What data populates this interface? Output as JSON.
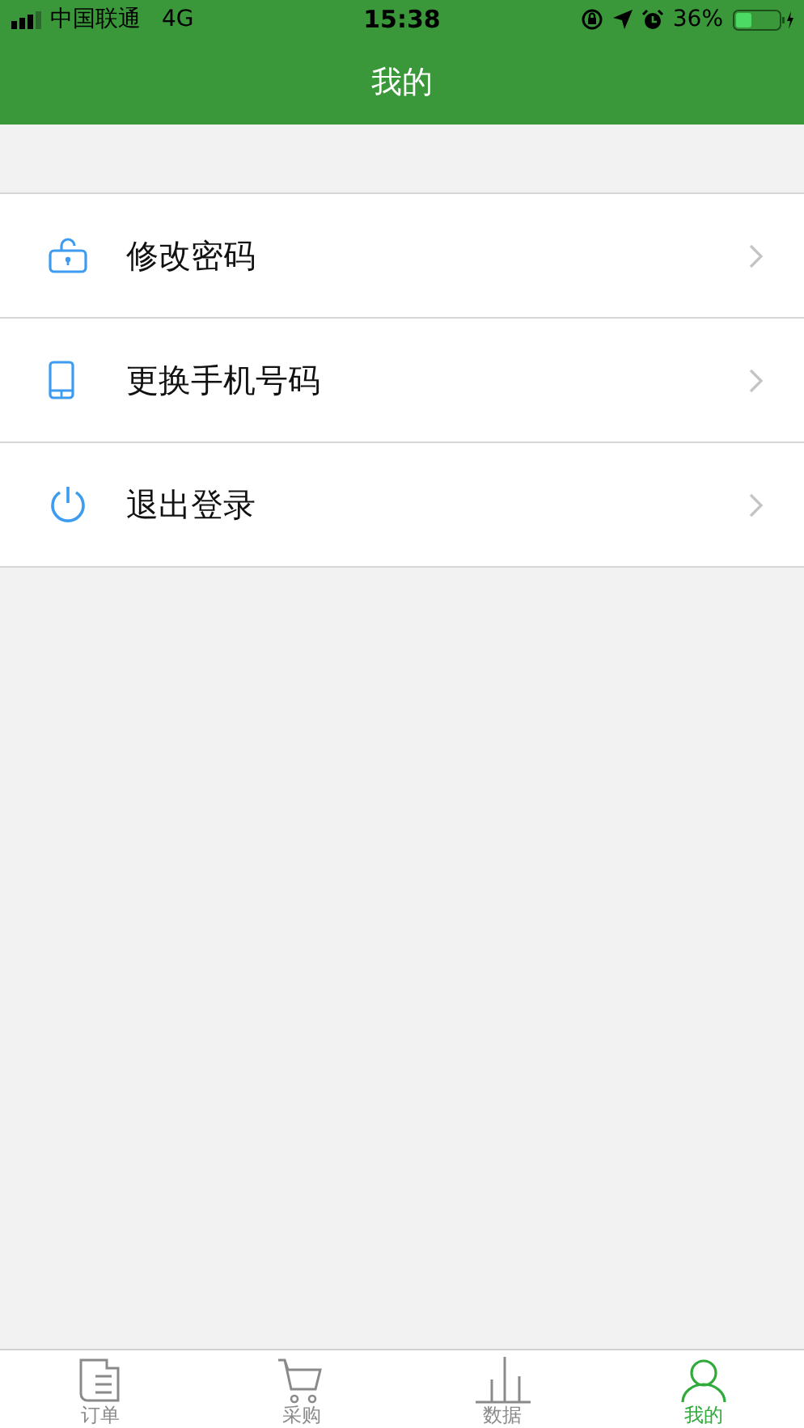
{
  "status_bar": {
    "carrier": "中国联通",
    "network": "4G",
    "time": "15:38",
    "battery": "36%"
  },
  "header": {
    "title": "我的"
  },
  "menu": [
    {
      "label": "修改密码"
    },
    {
      "label": "更换手机号码"
    },
    {
      "label": "退出登录"
    }
  ],
  "tab_bar": [
    {
      "label": "订单",
      "selected": false
    },
    {
      "label": "采购",
      "selected": false
    },
    {
      "label": "数据",
      "selected": false
    },
    {
      "label": "我的",
      "selected": true
    }
  ]
}
